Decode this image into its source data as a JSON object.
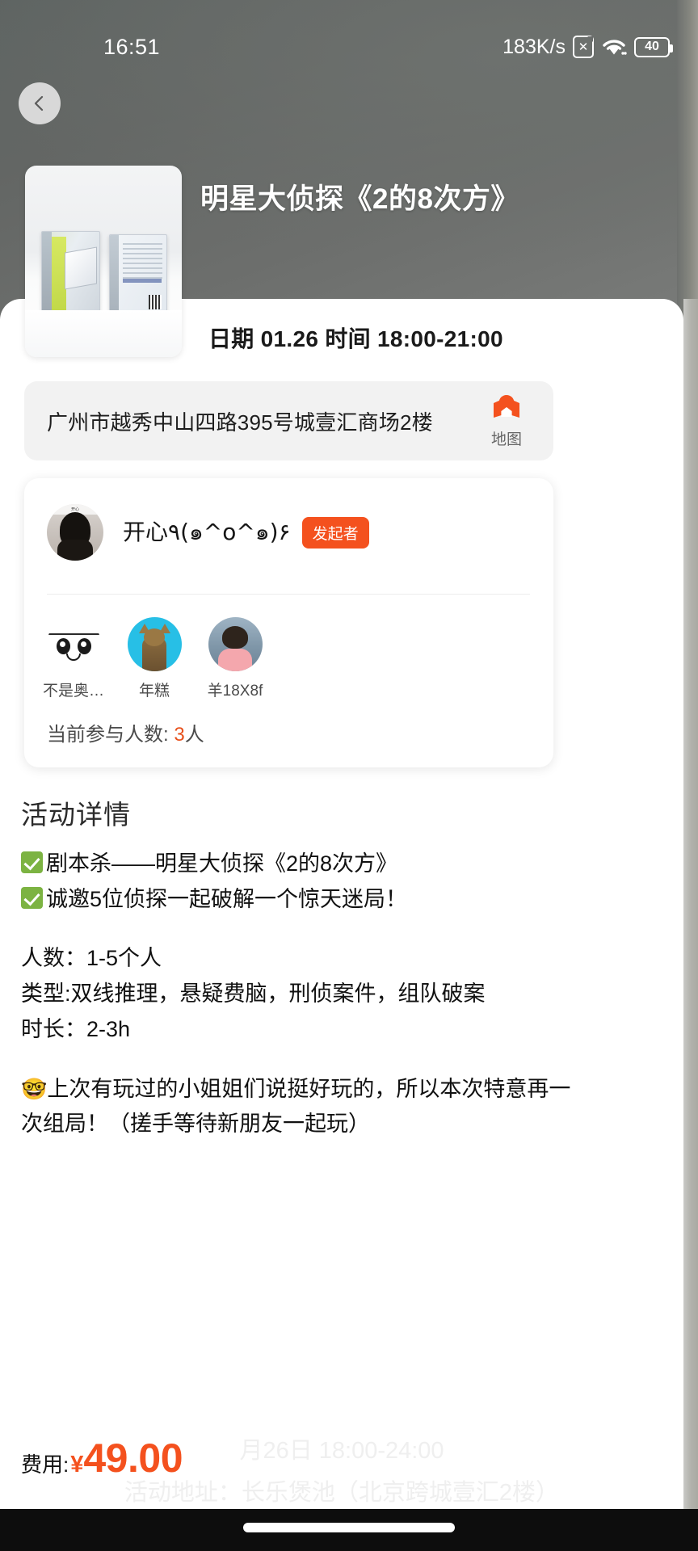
{
  "status_bar": {
    "time": "16:51",
    "network_speed": "183K/s",
    "sim_icon": "sim-x-icon",
    "wifi_icon": "wifi-icon",
    "battery_level": "40"
  },
  "header": {
    "back_icon": "back-chevron-icon",
    "title": "明星大侦探《2的8次方》",
    "thumbnail_alt": "剧本杀桌游盒装图片"
  },
  "event": {
    "date_time_line": "日期 01.26 时间 18:00-21:00",
    "address": "广州市越秀中山四路395号城壹汇商场2楼",
    "map_button_label": "地图",
    "map_icon": "map-pin-icon"
  },
  "participants": {
    "organizer": {
      "name": "开心٩(๑^o^๑)۶",
      "badge": "发起者"
    },
    "members": [
      {
        "name": "不是奥…"
      },
      {
        "name": "年糕"
      },
      {
        "name": "羊18X8f"
      }
    ],
    "count_label": "当前参与人数: ",
    "count_value": "3",
    "count_unit": "人"
  },
  "details": {
    "section_title": "活动详情",
    "check_lines": [
      "剧本杀——明星大侦探《2的8次方》",
      "诚邀5位侦探一起破解一个惊天迷局！"
    ],
    "info_lines": [
      "人数：1-5个人",
      "类型:双线推理，悬疑费脑，刑侦案件，组队破案",
      "时长：2-3h"
    ],
    "note_emoji": "🤓",
    "note_text": "上次有玩过的小姐姐们说挺好玩的，所以本次特意再一次组局！（搓手等待新朋友一起玩）"
  },
  "price_bar": {
    "label": "费用:",
    "currency": "¥",
    "amount": "49.00",
    "ghost_line_1": "月26日 18:00-24:00",
    "ghost_line_2": "活动地址：长乐煲池（北京跨城壹汇2楼）"
  },
  "colors": {
    "accent_orange": "#f4511e",
    "check_green": "#7cb342",
    "hero_gray": "#63676a"
  }
}
